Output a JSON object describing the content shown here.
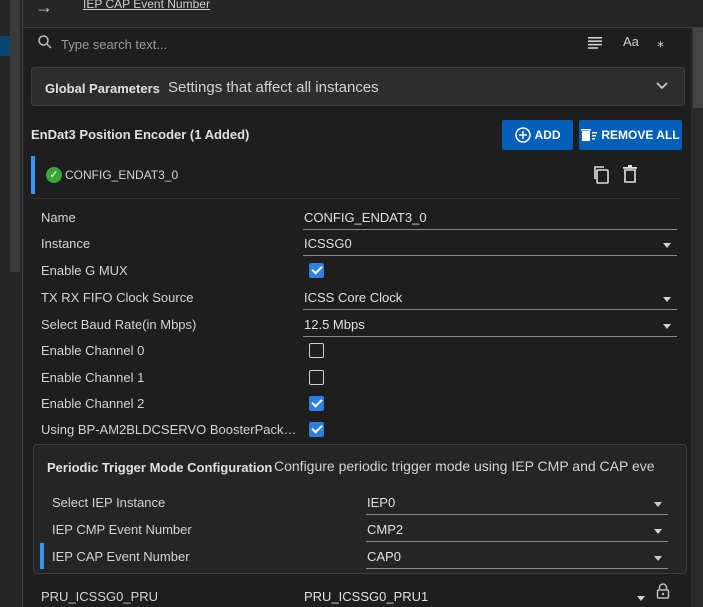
{
  "breadcrumb": "IEP CAP Event Number",
  "search": {
    "placeholder": "Type search text...",
    "case_label": "Aa"
  },
  "global": {
    "title": "Global Parameters",
    "description": "Settings that affect all instances"
  },
  "section": {
    "title": "EnDat3 Position Encoder (1 Added)",
    "add_label": "ADD",
    "remove_all_label": "REMOVE ALL"
  },
  "instance": {
    "name": "CONFIG_ENDAT3_0"
  },
  "fields": [
    {
      "label": "Name",
      "value": "CONFIG_ENDAT3_0"
    },
    {
      "label": "Instance",
      "value": "ICSSG0"
    },
    {
      "label": "Enable G MUX",
      "checked": true
    },
    {
      "label": "TX RX FIFO Clock Source",
      "value": "ICSS Core Clock"
    },
    {
      "label": "Select Baud Rate(in Mbps)",
      "value": "12.5 Mbps"
    },
    {
      "label": "Enable Channel 0",
      "checked": false
    },
    {
      "label": "Enable Channel 1",
      "checked": false
    },
    {
      "label": "Enable Channel 2",
      "checked": true
    },
    {
      "label": "Using BP-AM2BLDCSERVO BoosterPack…",
      "checked": true
    }
  ],
  "periodic": {
    "title": "Periodic Trigger Mode Configuration",
    "description": "Configure periodic trigger mode using IEP CMP and CAP eve",
    "fields": [
      {
        "label": "Select IEP Instance",
        "value": "IEP0"
      },
      {
        "label": "IEP CMP Event Number",
        "value": "CMP2"
      },
      {
        "label": "IEP CAP Event Number",
        "value": "CAP0"
      }
    ]
  },
  "pru": {
    "label": "PRU_ICSSG0_PRU",
    "value": "PRU_ICSSG0_PRU1"
  },
  "colors": {
    "accent": "#005fb8",
    "selection_bar": "#3794ff",
    "checkbox": "#2f7fe0",
    "ok": "#38a738"
  }
}
